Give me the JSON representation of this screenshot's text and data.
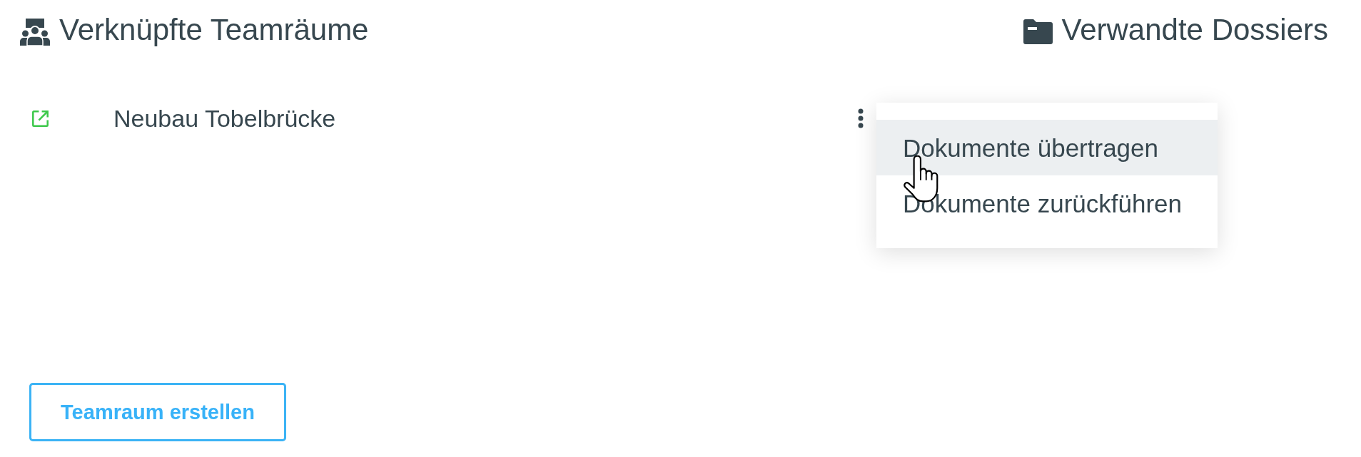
{
  "linked_teamrooms": {
    "title": "Verknüpfte Teamräume",
    "items": [
      {
        "name": "Neubau Tobelbrücke",
        "menu": [
          {
            "label": "Dokumente übertragen",
            "highlighted": true
          },
          {
            "label": "Dokumente zurückführen",
            "highlighted": false
          }
        ]
      }
    ],
    "create_button": "Teamraum erstellen"
  },
  "related_dossiers": {
    "title": "Verwandte Dossiers"
  }
}
